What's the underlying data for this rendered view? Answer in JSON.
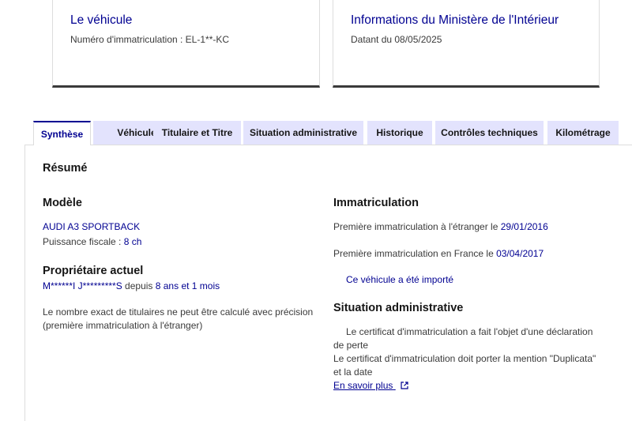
{
  "vehicle_card": {
    "title": "Le véhicule",
    "plate_label": "Numéro d'immatriculation : ",
    "plate_value": "EL-1**-KC"
  },
  "ministry_card": {
    "title": "Informations du Ministère de l'Intérieur",
    "date_text": "Datant du 08/05/2025"
  },
  "tabs": [
    {
      "label": "Synthèse",
      "active": true
    },
    {
      "label": "Véhicule",
      "active": false
    },
    {
      "label": "Titulaire et Titre",
      "active": false
    },
    {
      "label": "Situation administrative",
      "active": false
    },
    {
      "label": "Historique",
      "active": false
    },
    {
      "label": "Contrôles techniques",
      "active": false
    },
    {
      "label": "Kilométrage",
      "active": false
    }
  ],
  "summary": {
    "title": "Résumé",
    "model": {
      "heading": "Modèle",
      "name": "AUDI A3 SPORTBACK",
      "fiscal_label": "Puissance fiscale : ",
      "fiscal_value": "8 ch"
    },
    "owner": {
      "heading": "Propriétaire actuel",
      "name": "M******I J*********S",
      "since_label": " depuis ",
      "since_value": "8 ans et 1 mois",
      "note_line1": "Le nombre exact de titulaires ne peut être calculé avec précision",
      "note_line2": "(première immatriculation à l'étranger)"
    },
    "registration": {
      "heading": "Immatriculation",
      "foreign_label": "Première immatriculation à l'étranger le ",
      "foreign_date": "29/01/2016",
      "france_label": "Première immatriculation en France le ",
      "france_date": "03/04/2017",
      "imported_text": "Ce véhicule a été importé"
    },
    "admin": {
      "heading": "Situation administrative",
      "line1": "Le certificat d'immatriculation a fait l'objet d'une déclaration",
      "line2": "de perte",
      "line3": "Le certificat d'immatriculation doit porter la mention \"Duplicata\"",
      "line4": "et la date",
      "link_label": "En savoir plus"
    }
  },
  "colors": {
    "accent": "#000091",
    "tab_bg": "#e3e3fd",
    "text": "#161616",
    "muted": "#3a3a3a"
  }
}
